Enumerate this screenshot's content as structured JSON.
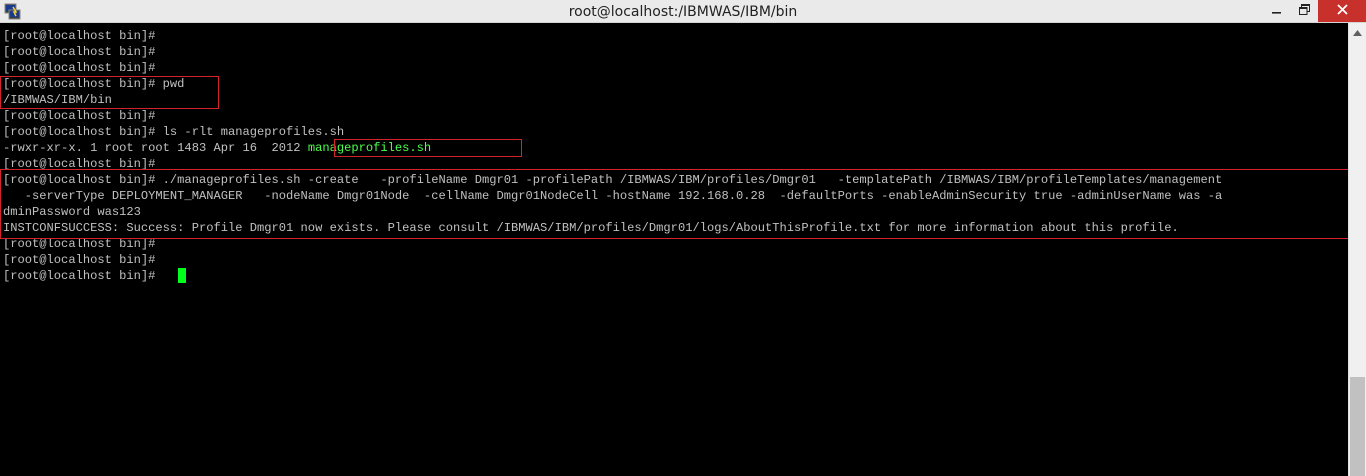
{
  "window": {
    "title": "root@localhost:/IBMWAS/IBM/bin",
    "controls": {
      "minimize_icon": "minimize-icon",
      "maximize_icon": "restore-icon",
      "close_icon": "close-icon"
    },
    "app_icon": "putty-icon"
  },
  "terminal": {
    "lines": [
      "[root@localhost bin]#",
      "[root@localhost bin]#",
      "[root@localhost bin]#",
      "[root@localhost bin]# pwd",
      "/IBMWAS/IBM/bin",
      "[root@localhost bin]#",
      "[root@localhost bin]# ls -rlt manageprofiles.sh",
      "-rwxr-xr-x. 1 root root 1483 Apr 16  2012 ",
      "[root@localhost bin]#",
      "[root@localhost bin]# ./manageprofiles.sh -create   -profileName Dmgr01 -profilePath /IBMWAS/IBM/profiles/Dmgr01   -templatePath /IBMWAS/IBM/profileTemplates/management",
      "   -serverType DEPLOYMENT_MANAGER   -nodeName Dmgr01Node  -cellName Dmgr01NodeCell -hostName 192.168.0.28  -defaultPorts -enableAdminSecurity true -adminUserName was -a",
      "dminPassword was123",
      "INSTCONFSUCCESS: Success: Profile Dmgr01 now exists. Please consult /IBMWAS/IBM/profiles/Dmgr01/logs/AboutThisProfile.txt for more information about this profile.",
      "[root@localhost bin]#",
      "[root@localhost bin]#",
      "[root@localhost bin]# "
    ],
    "highlighted_filename": "manageprofiles.sh",
    "colors": {
      "background": "#000000",
      "text": "#c0c0c0",
      "highlight": "#4bff4b",
      "cursor": "#00ff1a",
      "annotation_box": "#d3242a"
    }
  }
}
